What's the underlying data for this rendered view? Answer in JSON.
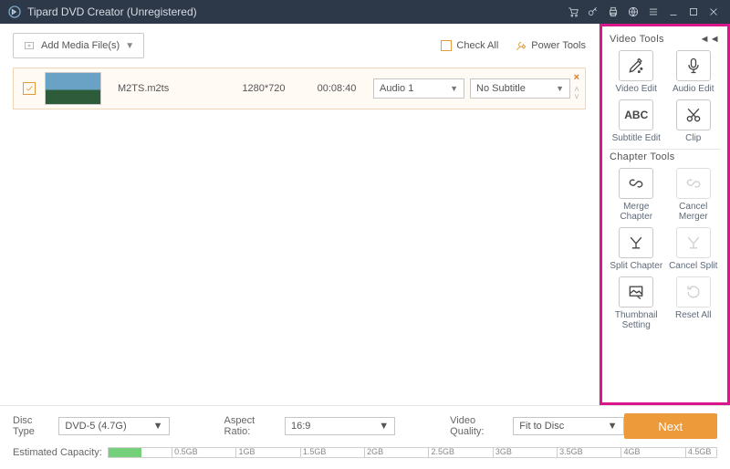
{
  "title": "Tipard DVD Creator (Unregistered)",
  "toolbar": {
    "addLabel": "Add Media File(s)",
    "checkAll": "Check All",
    "powerTools": "Power Tools"
  },
  "item": {
    "name": "M2TS.m2ts",
    "resolution": "1280*720",
    "duration": "00:08:40",
    "audio": "Audio 1",
    "subtitle": "No Subtitle"
  },
  "side": {
    "videoTitle": "Video Tools",
    "chapterTitle": "Chapter Tools",
    "videoEdit": "Video Edit",
    "audioEdit": "Audio Edit",
    "subtitleEdit": "Subtitle Edit",
    "clip": "Clip",
    "merge": "Merge Chapter",
    "cancelMerge": "Cancel Merger",
    "split": "Split Chapter",
    "cancelSplit": "Cancel Split",
    "thumb": "Thumbnail Setting",
    "reset": "Reset All"
  },
  "footer": {
    "discType": "Disc Type",
    "discVal": "DVD-5 (4.7G)",
    "aspect": "Aspect Ratio:",
    "aspectVal": "16:9",
    "quality": "Video Quality:",
    "qualityVal": "Fit to Disc",
    "next": "Next",
    "capacity": "Estimated Capacity:",
    "ticks": [
      "0.5GB",
      "1GB",
      "1.5GB",
      "2GB",
      "2.5GB",
      "3GB",
      "3.5GB",
      "4GB",
      "4.5GB"
    ]
  }
}
